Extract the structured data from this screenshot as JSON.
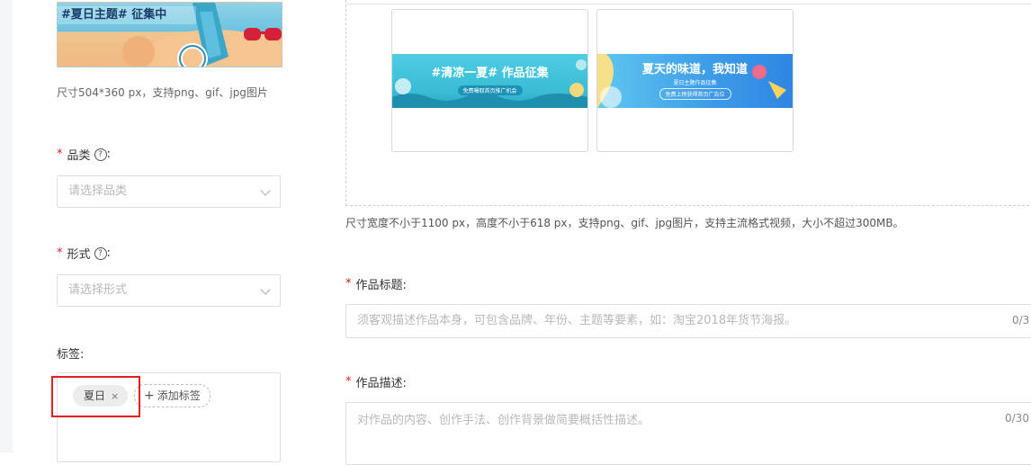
{
  "left": {
    "cover_banner_text": "#夏日主题# 征集中",
    "cover_hint": "尺寸504*360 px，支持png、gif、jpg图片",
    "category": {
      "label": "品类",
      "help": "?",
      "suffix": ":",
      "placeholder": "请选择品类"
    },
    "form": {
      "label": "形式",
      "help": "?",
      "suffix": ":",
      "placeholder": "请选择形式"
    },
    "tags": {
      "label": "标签:",
      "items": [
        {
          "text": "夏日",
          "remove": "×"
        }
      ],
      "add_label": "添加标签",
      "add_icon": "+"
    }
  },
  "right": {
    "banners": [
      {
        "title": "#清凉一夏# 作品征集",
        "subtitle": "免费曝取首页推广机会",
        "color": "#45c6dd"
      },
      {
        "title": "夏天的味道，我知道",
        "subtitle": "夏日主题作品征集",
        "subtitle2": "免费上榜获得首页广告位",
        "color": "#3e9be9"
      }
    ],
    "upload_hint": "尺寸宽度不小于1100 px，高度不小于618 px，支持png、gif、jpg图片，支持主流格式视频，大小不超过300MB。",
    "title_field": {
      "label": "作品标题:",
      "placeholder": "须客观描述作品本身，可包含品牌、年份、主题等要素，如：淘宝2018年货节海报。",
      "counter": "0/3"
    },
    "desc_field": {
      "label": "作品描述:",
      "placeholder": "对作品的内容、创作手法、创作背景做简要概括性描述。",
      "counter": "0/30"
    }
  },
  "required_mark": "*",
  "colors": {
    "required": "#e02020",
    "highlight": "#e52020",
    "border": "#dcdfe6"
  }
}
